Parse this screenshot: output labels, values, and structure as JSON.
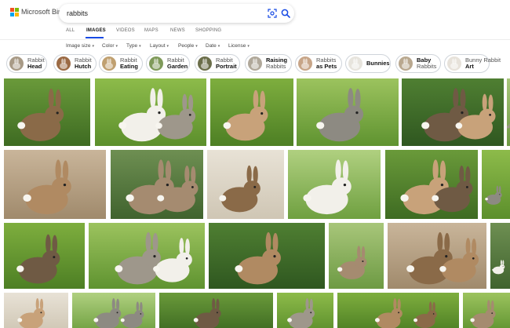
{
  "brand": {
    "name": "Microsoft Bing",
    "logo_colors": [
      "#f25022",
      "#7fba00",
      "#00a4ef",
      "#ffb900"
    ]
  },
  "search": {
    "query": "rabbits",
    "icons": [
      "visual-search-icon",
      "search-icon"
    ]
  },
  "tabs": [
    {
      "label": "ALL",
      "active": false
    },
    {
      "label": "IMAGES",
      "active": true
    },
    {
      "label": "VIDEOS",
      "active": false
    },
    {
      "label": "MAPS",
      "active": false
    },
    {
      "label": "NEWS",
      "active": false
    },
    {
      "label": "SHOPPING",
      "active": false
    }
  ],
  "filters": [
    {
      "label": "Image size"
    },
    {
      "label": "Color"
    },
    {
      "label": "Type"
    },
    {
      "label": "Layout"
    },
    {
      "label": "People"
    },
    {
      "label": "Date"
    },
    {
      "label": "License"
    }
  ],
  "chips": [
    {
      "line1": "Rabbit",
      "line2": "Head",
      "bold": true
    },
    {
      "line1": "Rabbit",
      "line2": "Hutch",
      "bold": true
    },
    {
      "line1": "Rabbit",
      "line2": "Eating",
      "bold": true
    },
    {
      "line1": "Rabbit",
      "line2": "Garden",
      "bold": true
    },
    {
      "line1": "Rabbit",
      "line2": "Portrait",
      "bold": true
    },
    {
      "line1": "Raising",
      "line2": "Rabbits",
      "bold": false,
      "first_bold": true
    },
    {
      "line1": "Rabbits",
      "line2": "as Pets",
      "bold": true
    },
    {
      "line1": "",
      "line2": "Bunnies",
      "bold": true
    },
    {
      "line1": "Baby",
      "line2": "Rabbits",
      "bold": false,
      "first_bold": true
    },
    {
      "line1": "Bunny Rabbit",
      "line2": "Art",
      "bold": true
    }
  ],
  "colors": {
    "accent": "#174ae4",
    "grass": "#5c9a2e",
    "fur_brown": "#8a6a48",
    "fur_grey": "#8d8a82",
    "fur_white": "#f2f0ea"
  }
}
